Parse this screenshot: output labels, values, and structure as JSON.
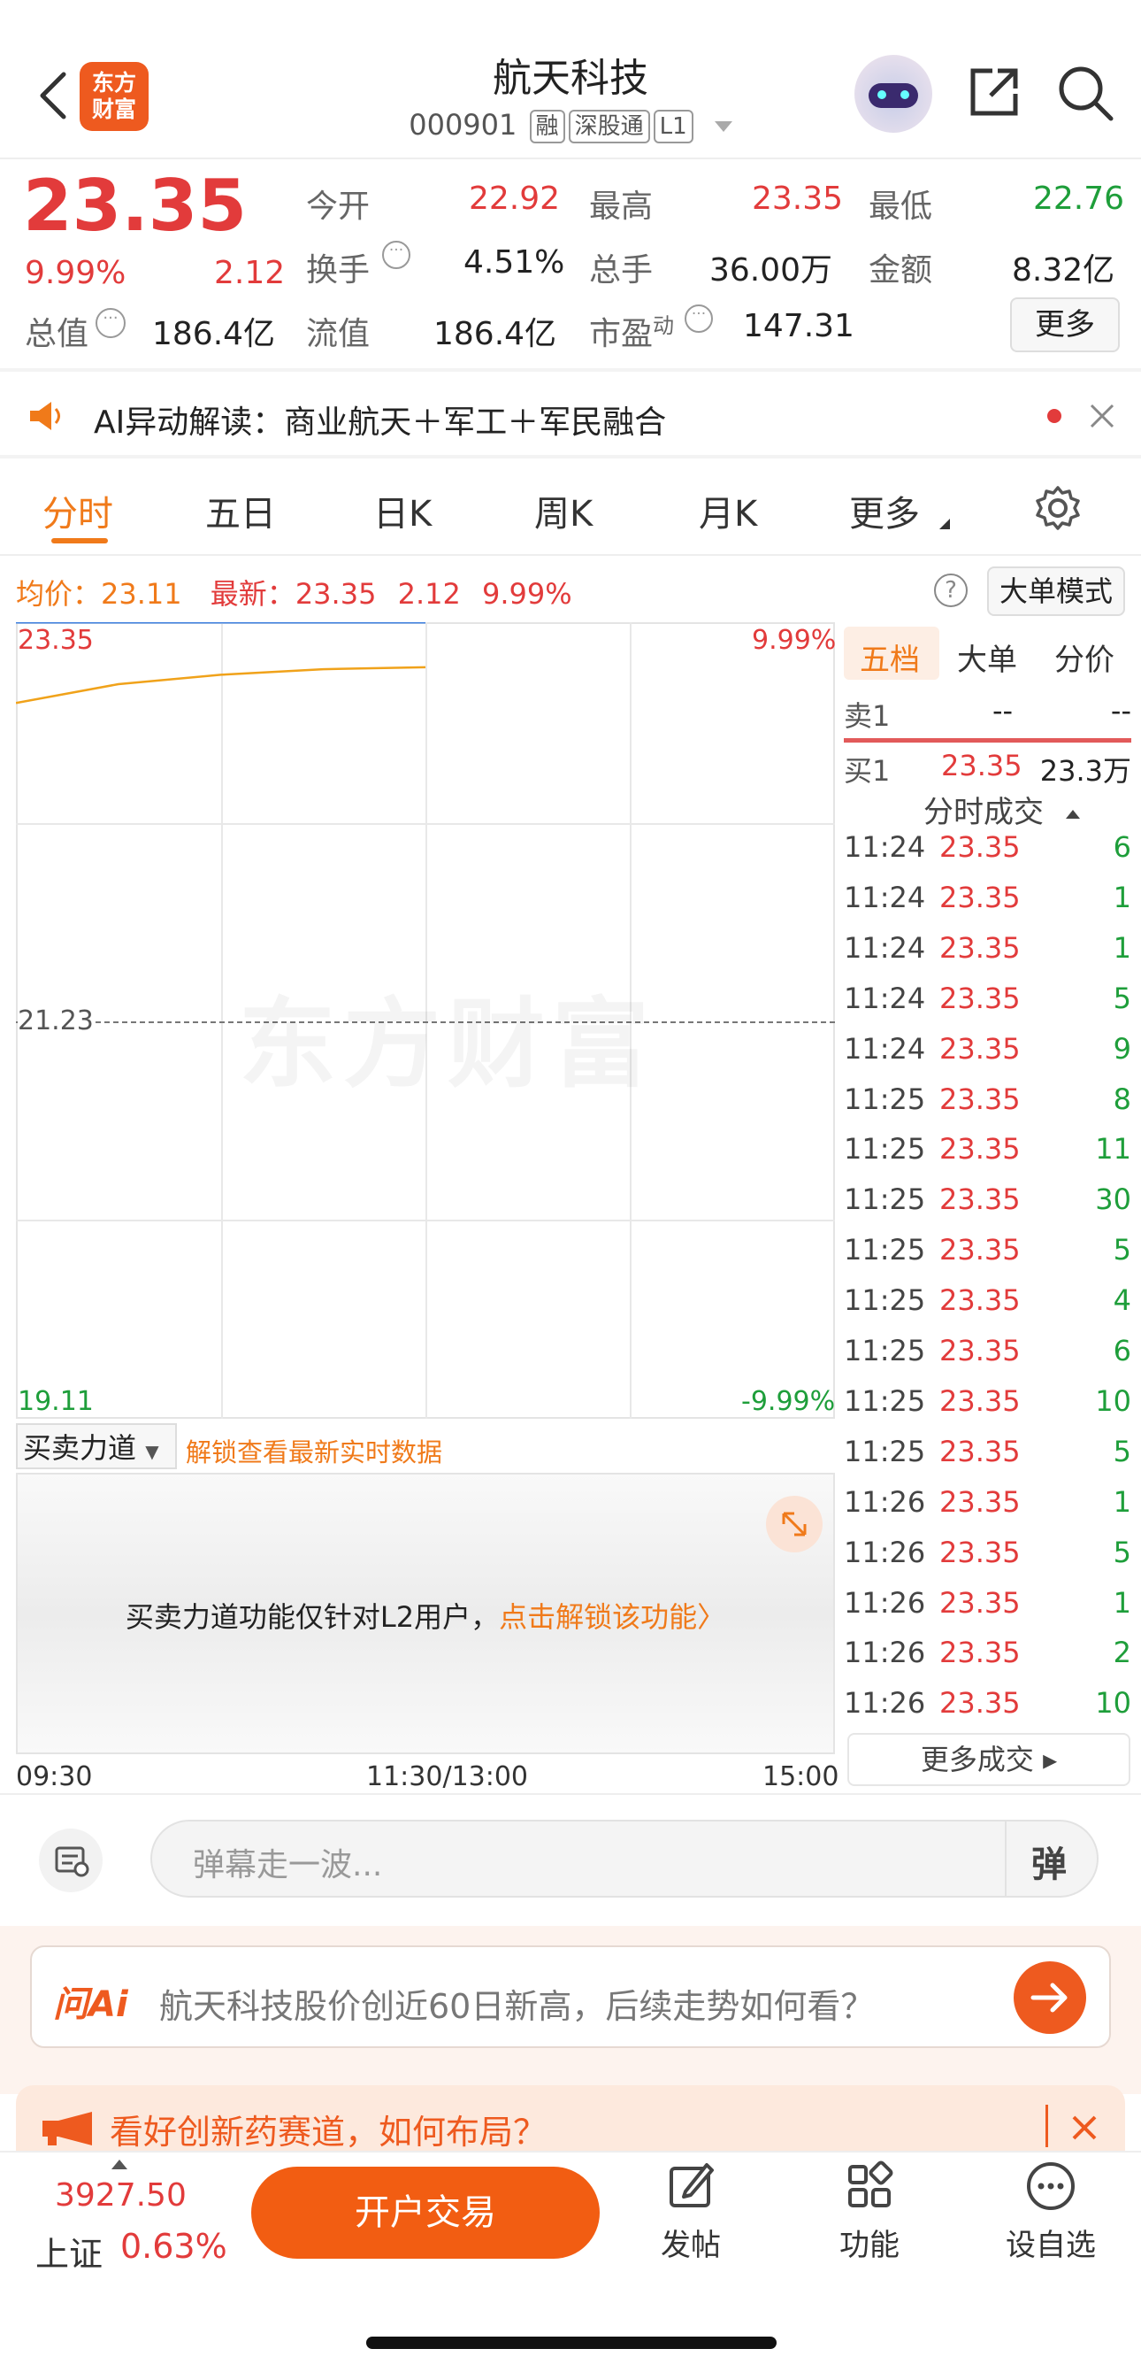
{
  "header": {
    "title": "航天科技",
    "code": "000901",
    "badges": [
      "融",
      "深股通",
      "L1"
    ],
    "logo_text_1": "东方",
    "logo_text_2": "财富"
  },
  "quote": {
    "price": "23.35",
    "change_pct": "9.99%",
    "change": "2.12",
    "open_label": "今开",
    "open": "22.92",
    "high_label": "最高",
    "high": "23.35",
    "low_label": "最低",
    "low": "22.76",
    "turnover_label": "换手",
    "turnover": "4.51%",
    "volume_label": "总手",
    "volume": "36.00万",
    "amount_label": "金额",
    "amount": "8.32亿",
    "mktcap_label": "总值",
    "mktcap": "186.4亿",
    "float_label": "流值",
    "float": "186.4亿",
    "pe_label": "市盈",
    "pe_sup": "动",
    "pe": "147.31",
    "more_button": "更多"
  },
  "ai_notice": {
    "text": "AI异动解读：商业航天＋军工＋军民融合"
  },
  "tabs": [
    "分时",
    "五日",
    "日K",
    "周K",
    "月K",
    "更多"
  ],
  "chart_info": {
    "avg_label": "均价：",
    "avg": "23.11",
    "latest_label": "最新：",
    "latest": "23.35",
    "change": "2.12",
    "pct": "9.99%",
    "mode_button": "大单模式"
  },
  "chart_data": {
    "type": "line",
    "y_labels_left": [
      "23.35",
      "21.23",
      "19.11"
    ],
    "y_labels_right": [
      "9.99%",
      "-9.99%"
    ],
    "x_labels": [
      "09:30",
      "11:30/13:00",
      "15:00"
    ],
    "ylim": [
      19.11,
      23.35
    ],
    "series": [
      {
        "values": [
          23.35,
          23.35,
          23.35,
          23.35,
          23.35
        ]
      },
      {
        "values": [
          22.92,
          23.02,
          23.07,
          23.1,
          23.11
        ]
      }
    ],
    "colors": {
      "price": "#3d7fe0",
      "avg": "#f0a21a"
    },
    "watermark": "东方财富"
  },
  "order_book": {
    "tabs": [
      "五档",
      "大单",
      "分价"
    ],
    "sell1_label": "卖1",
    "sell1_price": "--",
    "sell1_vol": "--",
    "buy1_label": "买1",
    "buy1_price": "23.35",
    "buy1_vol": "23.3万"
  },
  "ticks_header": "分时成交",
  "ticks": [
    {
      "time": "11:24",
      "price": "23.35",
      "vol": "6"
    },
    {
      "time": "11:24",
      "price": "23.35",
      "vol": "1"
    },
    {
      "time": "11:24",
      "price": "23.35",
      "vol": "1"
    },
    {
      "time": "11:24",
      "price": "23.35",
      "vol": "5"
    },
    {
      "time": "11:24",
      "price": "23.35",
      "vol": "9"
    },
    {
      "time": "11:25",
      "price": "23.35",
      "vol": "8"
    },
    {
      "time": "11:25",
      "price": "23.35",
      "vol": "11"
    },
    {
      "time": "11:25",
      "price": "23.35",
      "vol": "30"
    },
    {
      "time": "11:25",
      "price": "23.35",
      "vol": "5"
    },
    {
      "time": "11:25",
      "price": "23.35",
      "vol": "4"
    },
    {
      "time": "11:25",
      "price": "23.35",
      "vol": "6"
    },
    {
      "time": "11:25",
      "price": "23.35",
      "vol": "10"
    },
    {
      "time": "11:25",
      "price": "23.35",
      "vol": "5"
    },
    {
      "time": "11:26",
      "price": "23.35",
      "vol": "1"
    },
    {
      "time": "11:26",
      "price": "23.35",
      "vol": "5"
    },
    {
      "time": "11:26",
      "price": "23.35",
      "vol": "1"
    },
    {
      "time": "11:26",
      "price": "23.35",
      "vol": "2"
    },
    {
      "time": "11:26",
      "price": "23.35",
      "vol": "10"
    }
  ],
  "more_ticks": "更多成交",
  "force": {
    "select": "买卖力道",
    "unlock_link": "解锁查看最新实时数据",
    "panel_text": "买卖力道功能仅针对L2用户，",
    "panel_link": "点击解锁该功能"
  },
  "danmaku": {
    "placeholder": "弹幕走一波...",
    "button": "弹"
  },
  "ai_ask": {
    "logo": "问Ai",
    "text": "航天科技股价创近60日新高，后续走势如何看？"
  },
  "promo": {
    "text": "看好创新药赛道，如何布局？"
  },
  "bottom": {
    "index_value": "3927.50",
    "index_name": "上证",
    "index_pct": "0.63%",
    "trade_button": "开户交易",
    "post": "发帖",
    "func": "功能",
    "watch": "设自选"
  }
}
